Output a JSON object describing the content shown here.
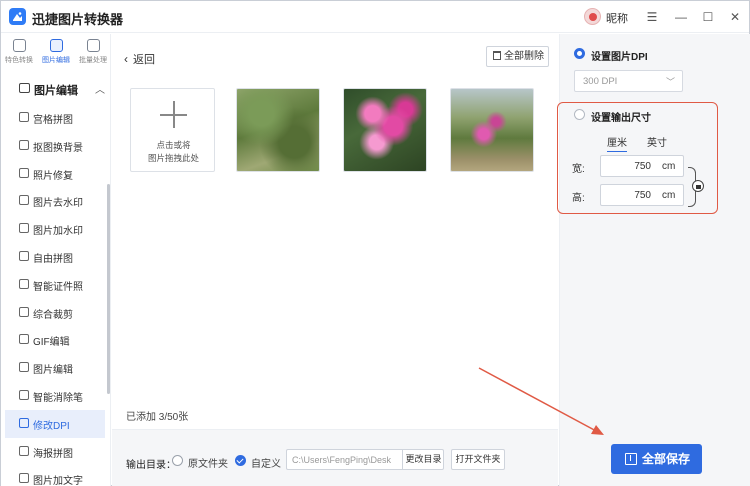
{
  "app": {
    "title": "迅捷图片转换器",
    "nickname": "昵称"
  },
  "window_controls": {
    "menu": "☰",
    "minimize": "—",
    "maximize": "☐",
    "close": "✕"
  },
  "topnav": [
    {
      "label": "特色转换",
      "icon": "convert-icon"
    },
    {
      "label": "图片编辑",
      "icon": "edit-icon"
    },
    {
      "label": "批量处理",
      "icon": "batch-icon"
    }
  ],
  "sidebar": {
    "group_title": "图片编辑",
    "items": [
      {
        "label": "宫格拼图"
      },
      {
        "label": "抠图换背景"
      },
      {
        "label": "照片修复"
      },
      {
        "label": "图片去水印"
      },
      {
        "label": "图片加水印"
      },
      {
        "label": "自由拼图"
      },
      {
        "label": "智能证件照"
      },
      {
        "label": "综合裁剪"
      },
      {
        "label": "GIF编辑"
      },
      {
        "label": "图片编辑"
      },
      {
        "label": "智能消除笔"
      },
      {
        "label": "修改DPI"
      },
      {
        "label": "海报拼图"
      },
      {
        "label": "图片加文字"
      }
    ],
    "active_index": 11
  },
  "main": {
    "back_label": "返回",
    "clear_all_label": "全部删除",
    "add_tile": {
      "line1": "点击或将",
      "line2": "图片拖拽此处"
    },
    "added_count": "已添加 3/50张"
  },
  "output": {
    "label": "输出目录：",
    "option_original": "原文件夹",
    "option_custom": "自定义",
    "path": "C:\\Users\\FengPing\\Desk",
    "change_dir_label": "更改目录",
    "open_folder_label": "打开文件夹"
  },
  "settings": {
    "dpi_label": "设置图片DPI",
    "dpi_value": "300 DPI",
    "size_label": "设置输出尺寸",
    "unit_cm": "厘米",
    "unit_inch": "英寸",
    "width_label": "宽:",
    "height_label": "高:",
    "width_value": "750",
    "height_value": "750",
    "unit": "cm",
    "save_all_label": "全部保存"
  },
  "colors": {
    "accent": "#2f6be0",
    "highlight": "#e05a45"
  }
}
